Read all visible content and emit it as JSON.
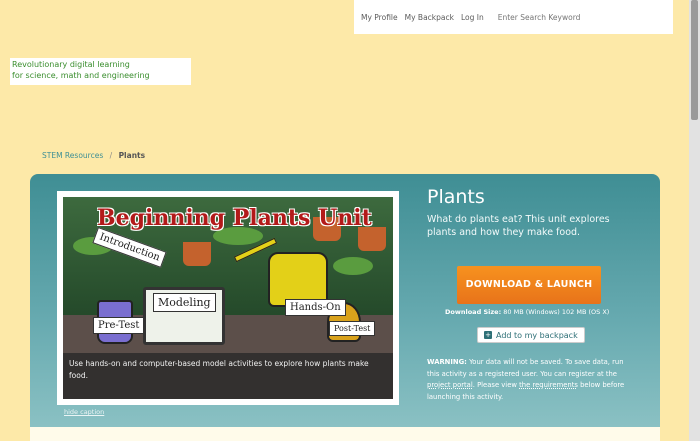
{
  "topnav": {
    "profile": "My Profile",
    "backpack": "My Backpack",
    "login": "Log In",
    "search_placeholder": "Enter Search Keyword"
  },
  "tagline": {
    "line1": "Revolutionary digital learning",
    "line2": "for science, math and engineering"
  },
  "breadcrumb": {
    "parent": "STEM Resources",
    "separator": "/",
    "current": "Plants"
  },
  "hero": {
    "image_title": "Beginning Plants Unit",
    "tags": {
      "intro": "Introduction",
      "pretest": "Pre-Test",
      "modeling": "Modeling",
      "handson": "Hands-On",
      "posttest": "Post-Test"
    },
    "caption": "Use hands-on and computer-based model activities to explore how plants make food.",
    "hide_caption": "hide caption"
  },
  "info": {
    "title": "Plants",
    "description": "What do plants eat? This unit explores plants and how they make food.",
    "launch_button": "DOWNLOAD & LAUNCH",
    "download_label": "Download Size:",
    "download_value": "80 MB (Windows) 102 MB (OS X)",
    "backpack_button": "Add to my backpack",
    "warning_label": "WARNING:",
    "warning_text1": "Your data will not be saved. To save data, run this activity as a registered user. You can register at the",
    "warning_link1": "project portal",
    "warning_text2": ". Please view",
    "warning_link2": "the requirements",
    "warning_text3": "below before launching this activity."
  },
  "colors": {
    "page_bg": "#fde9a8",
    "panel_top": "#3f8e94",
    "launch_orange": "#f7921e",
    "tagline_green": "#3a8e2e"
  }
}
